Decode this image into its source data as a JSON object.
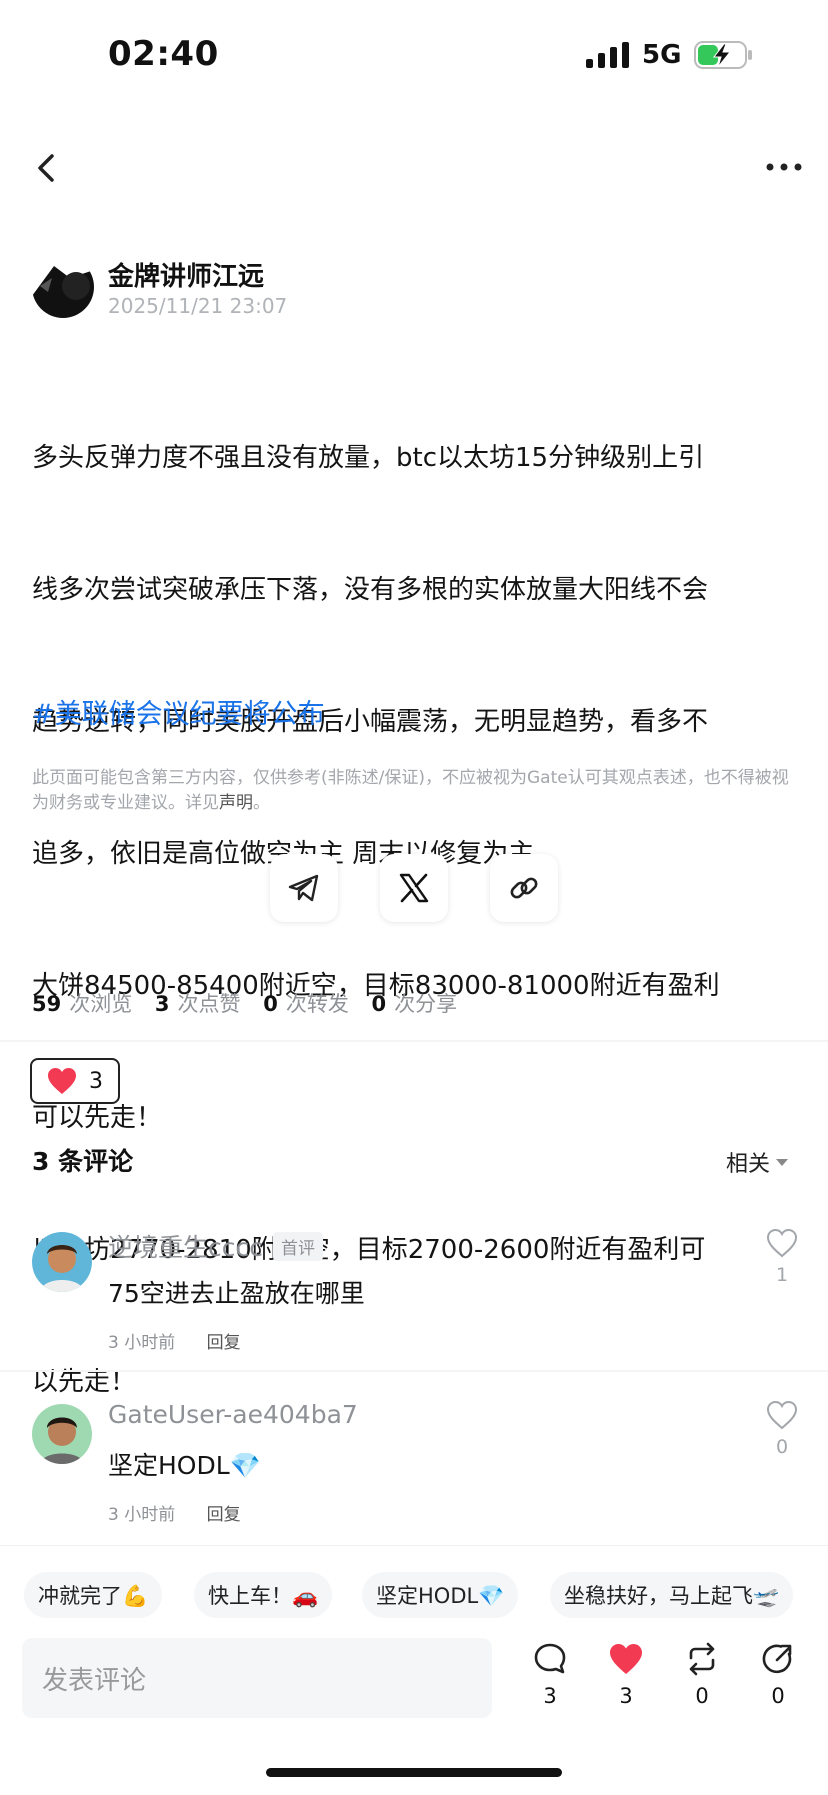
{
  "status_bar": {
    "time": "02:40",
    "network": "5G"
  },
  "author": {
    "name": "金牌讲师江远",
    "time": "2025/11/21 23:07"
  },
  "post": {
    "lines": [
      "多头反弹力度不强且没有放量，btc以太坊15分钟级别上引",
      "线多次尝试突破承压下落，没有多根的实体放量大阳线不会",
      "趋势逆转，同时美股开盘后小幅震荡，无明显趋势，看多不",
      "追多，依旧是高位做空为主 周末以修复为主",
      "大饼84500-85400附近空，目标83000-81000附近有盈利",
      "可以先走！",
      "以太坊2770-2810附近空，目标2700-2600附近有盈利可",
      "以先走！"
    ],
    "hashtag": "#美联储会议纪要将公布"
  },
  "disclaimer": {
    "text": "此页面可能包含第三方内容，仅供参考(非陈述/保证)，不应被视为Gate认可其观点表述，也不得被视为财务或专业建议。详见",
    "link": "声明",
    "end": "。"
  },
  "share": {
    "icons": [
      "telegram-icon",
      "x-icon",
      "link-icon"
    ]
  },
  "stats": {
    "views": "59",
    "views_label": "次浏览",
    "likes": "3",
    "likes_label": "次点赞",
    "reposts": "0",
    "reposts_label": "次转发",
    "shares": "0",
    "shares_label": "次分享"
  },
  "like_pill": {
    "count": "3"
  },
  "comments": {
    "title": "3 条评论",
    "sort": "相关",
    "items": [
      {
        "user": "逆境重生cccc",
        "badge": "首评",
        "text": "75空进去止盈放在哪里",
        "time": "3 小时前",
        "reply": "回复",
        "likes": "1"
      },
      {
        "user": "GateUser-ae404ba7",
        "badge": "",
        "text": "坚定HODL💎",
        "time": "3 小时前",
        "reply": "回复",
        "likes": "0"
      }
    ]
  },
  "quick_replies": [
    "冲就完了💪",
    "快上车！🚗",
    "坚定HODL💎",
    "坐稳扶好，马上起飞🛫"
  ],
  "bottom_bar": {
    "placeholder": "发表评论",
    "comment_count": "3",
    "like_count": "3",
    "repost_count": "0",
    "share_count": "0"
  },
  "colors": {
    "accent_blue": "#1a73e8",
    "heart_red": "#f23a52",
    "battery_green": "#34c759"
  }
}
